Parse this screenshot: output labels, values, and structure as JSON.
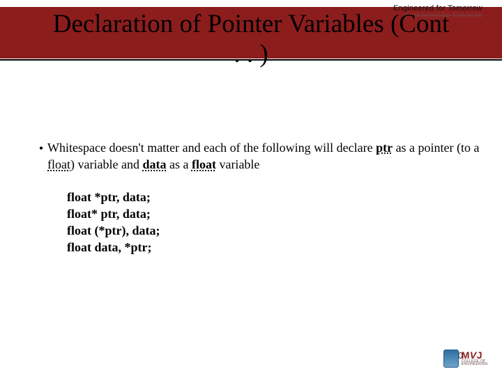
{
  "brand": {
    "tag": "Engineered for Tomorrow",
    "subtag": "Engineered for Tomorrow"
  },
  "title": {
    "line1": "Declaration of Pointer Variables (Cont",
    "line2": ". . )"
  },
  "bullet": {
    "marker": "•",
    "seg1": "Whitespace doesn't matter and each of the following will declare ",
    "ptr": "ptr",
    "seg2": " as a pointer (to a ",
    "float1": "float",
    "seg3": ") variable and ",
    "data": "data",
    "seg4": " as a ",
    "float2": "float",
    "seg5": " variable"
  },
  "code": {
    "l1": "float *ptr, data;",
    "l2": "float* ptr, data;",
    "l3": "float (*ptr), data;",
    "l4": "float data, *ptr;"
  },
  "footer": {
    "page": "10",
    "logo_main": "MVJ",
    "logo_sub1": "COLLEGE OF",
    "logo_sub2": "ENGINEERING"
  }
}
